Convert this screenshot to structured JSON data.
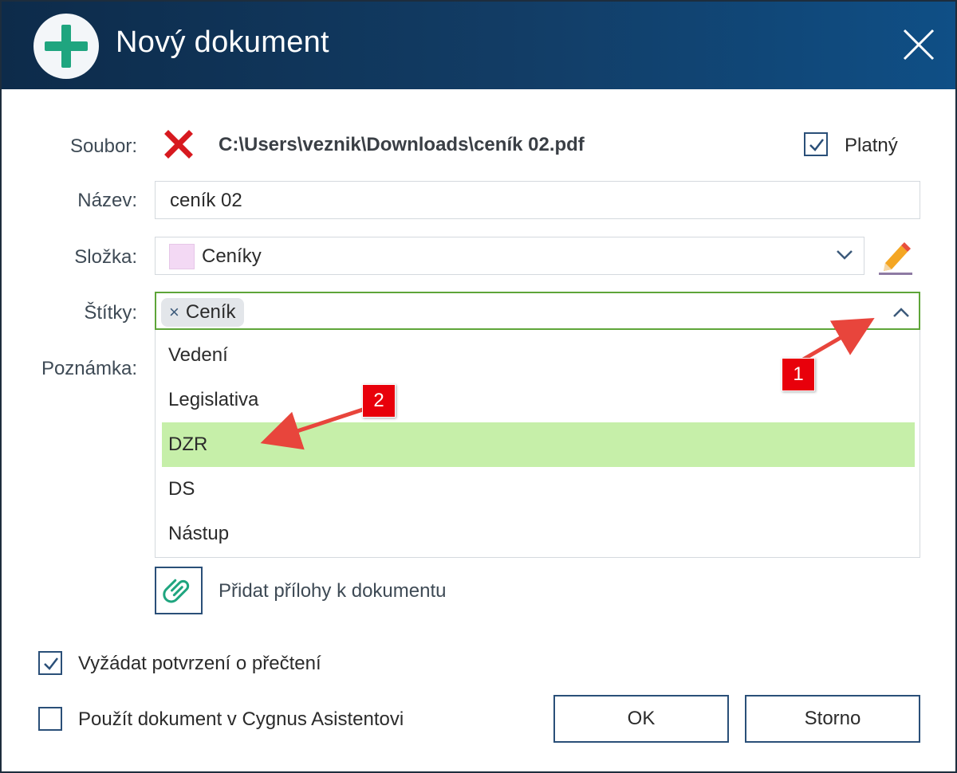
{
  "window": {
    "title": "Nový dokument",
    "icon": "plus-circle-icon",
    "close_icon": "close-icon"
  },
  "form": {
    "file": {
      "label": "Soubor:",
      "status_icon": "red-x-icon",
      "path": "C:\\Users\\veznik\\Downloads\\ceník 02.pdf"
    },
    "valid": {
      "label": "Platný",
      "checked": true
    },
    "name": {
      "label": "Název:",
      "value": "ceník 02"
    },
    "folder": {
      "label": "Složka:",
      "value": "Ceníky",
      "color": "#f3d9f4",
      "edit_icon": "pencil-icon"
    },
    "tags": {
      "label": "Štítky:",
      "selected": [
        {
          "label": "Ceník",
          "remove_glyph": "×"
        }
      ],
      "dropdown_open": true,
      "options": [
        {
          "label": "Vedení",
          "highlighted": false
        },
        {
          "label": "Legislativa",
          "highlighted": false
        },
        {
          "label": "DZR",
          "highlighted": true
        },
        {
          "label": "DS",
          "highlighted": false
        },
        {
          "label": "Nástup",
          "highlighted": false
        }
      ]
    },
    "note": {
      "label": "Poznámka:"
    },
    "attachments": {
      "label": "Přidat přílohy k dokumentu",
      "icon": "paperclip-icon"
    },
    "read_confirmation": {
      "label": "Vyžádat potvrzení o přečtení",
      "checked": true
    },
    "cygnus_assistant": {
      "label": "Použít dokument v Cygnus Asistentovi",
      "checked": false
    }
  },
  "buttons": {
    "ok": "OK",
    "cancel": "Storno"
  },
  "annotations": [
    {
      "number": "1"
    },
    {
      "number": "2"
    }
  ],
  "colors": {
    "titlebar": "#123d66",
    "accent_green": "#5ea539",
    "highlight": "#c6efa9",
    "annotation_red": "#e8000b",
    "plus_icon": "#1fa57f"
  }
}
